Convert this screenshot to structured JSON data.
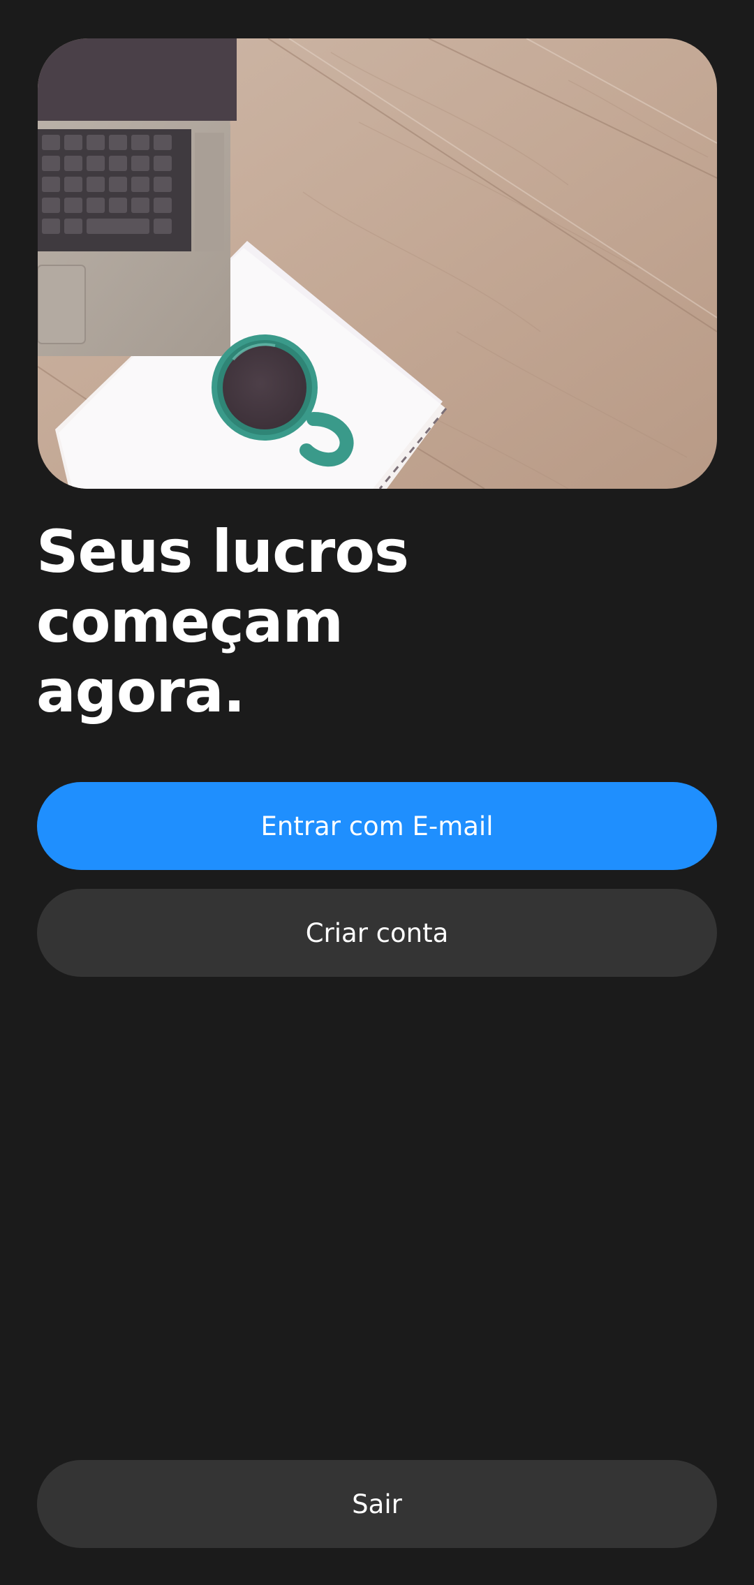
{
  "hero": {
    "image_icon": "laptop-coffee-desk-photo"
  },
  "headline": {
    "line1": "Seus lucros",
    "line2": "começam",
    "line3": "agora."
  },
  "actions": {
    "login_email_label": "Entrar com E-mail",
    "create_account_label": "Criar conta",
    "exit_label": "Sair"
  },
  "colors": {
    "background": "#1b1b1b",
    "primary": "#1f8ffe",
    "secondary": "#343434",
    "text": "#ffffff"
  }
}
